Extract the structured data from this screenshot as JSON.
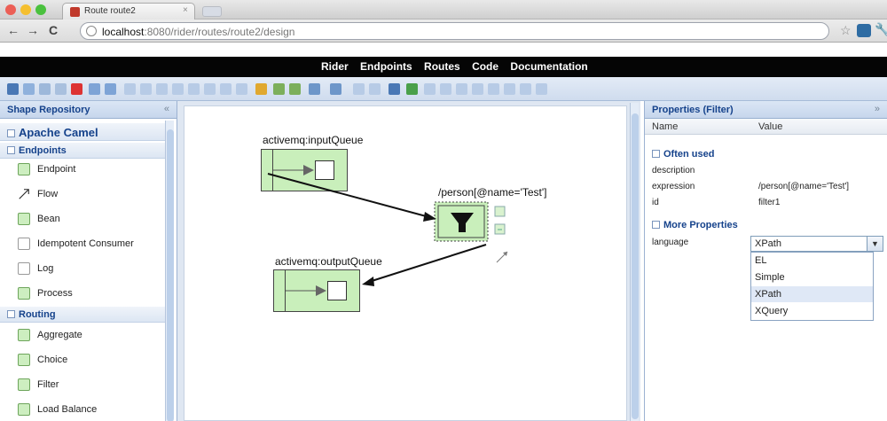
{
  "browser": {
    "tab_title": "Route route2",
    "tab_close": "×",
    "url_host": "localhost",
    "url_path": ":8080/rider/routes/route2/design",
    "back": "←",
    "forward": "→",
    "reload": "C",
    "star": "☆",
    "wrench": "🔧"
  },
  "menu": [
    "Rider",
    "Endpoints",
    "Routes",
    "Code",
    "Documentation"
  ],
  "repo": {
    "title": "Shape Repository",
    "collapse": "«",
    "root": "Apache Camel",
    "groups": [
      {
        "label": "Endpoints",
        "items": [
          "Endpoint",
          "Flow",
          "Bean",
          "Idempotent Consumer",
          "Log",
          "Process"
        ]
      },
      {
        "label": "Routing",
        "items": [
          "Aggregate",
          "Choice",
          "Filter",
          "Load Balance"
        ]
      }
    ]
  },
  "canvas": {
    "input_label": "activemq:inputQueue",
    "filter_label": "/person[@name='Test']",
    "output_label": "activemq:outputQueue"
  },
  "properties": {
    "title": "Properties (Filter)",
    "collapse": "»",
    "col_name": "Name",
    "col_value": "Value",
    "often_used": "Often used",
    "rows": [
      {
        "k": "description",
        "v": ""
      },
      {
        "k": "expression",
        "v": "/person[@name='Test']"
      },
      {
        "k": "id",
        "v": "filter1"
      }
    ],
    "more": "More Properties",
    "language_key": "language",
    "language_value": "XPath",
    "options": [
      "EL",
      "Simple",
      "XPath",
      "XQuery"
    ],
    "selected_option": "XPath"
  },
  "colors": {
    "node_fill": "#c9efbb",
    "menubar": "#050505",
    "header_text": "#15428b"
  }
}
